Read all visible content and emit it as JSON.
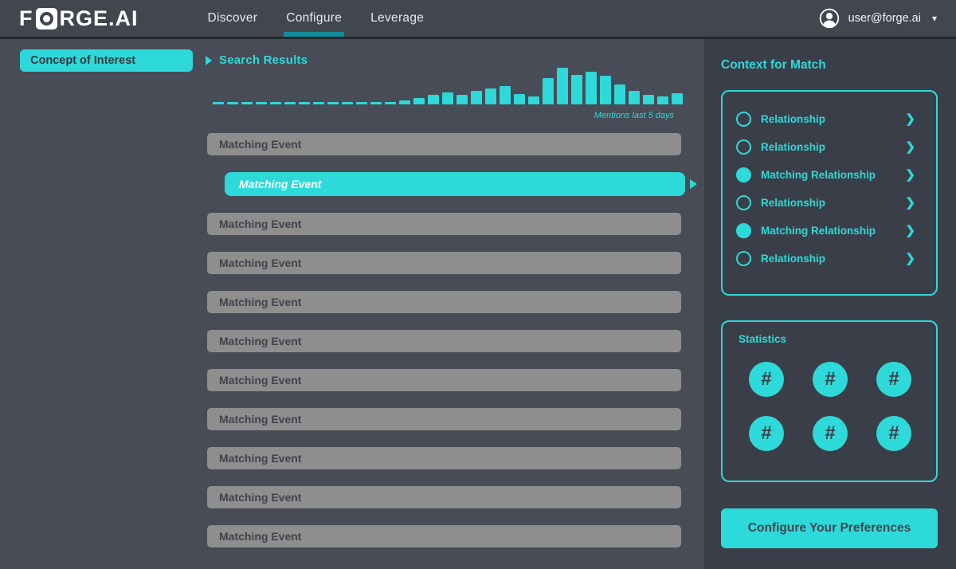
{
  "brand": {
    "prefix": "F",
    "suffix": "RGE.AI",
    "logo_icon": "forge-aperture-o"
  },
  "nav": {
    "items": [
      {
        "label": "Discover",
        "active": false
      },
      {
        "label": "Configure",
        "active": true
      },
      {
        "label": "Leverage",
        "active": false
      }
    ],
    "user": {
      "email": "user@forge.ai",
      "avatar_icon": "user-avatar",
      "caret_icon": "chevron-down",
      "caret_glyph": "▾"
    }
  },
  "search": {
    "value": "Concept of Interest",
    "icon": "search-magnifier"
  },
  "results": {
    "heading": "Search Results",
    "events": [
      {
        "label": "Matching Event",
        "selected": false
      },
      {
        "label": "Matching Event",
        "selected": true
      },
      {
        "label": "Matching Event",
        "selected": false
      },
      {
        "label": "Matching Event",
        "selected": false
      },
      {
        "label": "Matching Event",
        "selected": false
      },
      {
        "label": "Matching Event",
        "selected": false
      },
      {
        "label": "Matching Event",
        "selected": false
      },
      {
        "label": "Matching Event",
        "selected": false
      },
      {
        "label": "Matching Event",
        "selected": false
      },
      {
        "label": "Matching Event",
        "selected": false
      },
      {
        "label": "Matching Event",
        "selected": false
      }
    ]
  },
  "chart_data": {
    "type": "bar",
    "title": "",
    "caption": "Mentions last 5 days",
    "x": "time buckets over the last 5 days (unlabeled ticks, 33 bars)",
    "series_label": "Mentions",
    "values": [
      3,
      3,
      3,
      3,
      3,
      3,
      3,
      3,
      3,
      3,
      3,
      3,
      3,
      5,
      8,
      12,
      15,
      12,
      17,
      20,
      23,
      13,
      10,
      33,
      46,
      37,
      41,
      36,
      25,
      17,
      12,
      10,
      14
    ],
    "ylim": [
      0,
      46
    ],
    "unit": "relative bar height (no numeric axis shown)",
    "color": "#2ed9d9",
    "grid": false,
    "legend": "none"
  },
  "context": {
    "heading": "Context for Match",
    "items": [
      {
        "label": "Relationship",
        "matching": false
      },
      {
        "label": "Relationship",
        "matching": false
      },
      {
        "label": "Matching Relationship",
        "matching": true
      },
      {
        "label": "Relationship",
        "matching": false
      },
      {
        "label": "Matching Relationship",
        "matching": true
      },
      {
        "label": "Relationship",
        "matching": false
      }
    ],
    "chevron_glyph": "❯"
  },
  "statistics": {
    "heading": "Statistics",
    "values": [
      "#",
      "#",
      "#",
      "#",
      "#",
      "#"
    ]
  },
  "cta": {
    "label": "Configure Your Preferences"
  },
  "colors": {
    "teal": "#2ed9d9",
    "teal_dark": "#118a9b",
    "nav_bg": "#42464f",
    "main_bg": "#474c56",
    "sidebar_bg": "#3a3e48",
    "row_gray": "#8e8e8e",
    "text_dark": "#373c46",
    "text_light": "#ffffff"
  }
}
